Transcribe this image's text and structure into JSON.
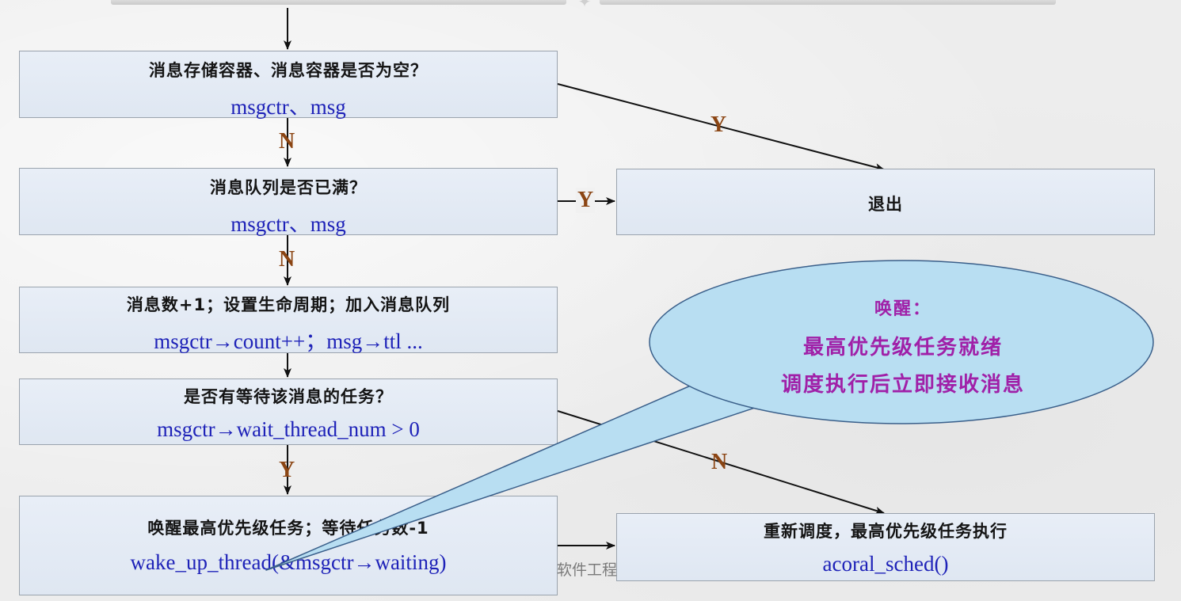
{
  "boxes": {
    "check_empty": {
      "zh": "消息存储容器、消息容器是否为空？",
      "en": "msgctr、msg"
    },
    "check_full": {
      "zh": "消息队列是否已满？",
      "en": "msgctr、msg"
    },
    "exit": {
      "zh": "退出"
    },
    "enqueue": {
      "zh": "消息数+1；设置生命周期；加入消息队列",
      "en": "msgctr→count++；msg→ttl ..."
    },
    "check_waiting": {
      "zh": "是否有等待该消息的任务？",
      "en": "msgctr→wait_thread_num > 0"
    },
    "wake_up": {
      "zh": "唤醒最高优先级任务；等待任务数-1",
      "en": "wake_up_thread(&msgctr→waiting)"
    },
    "resched": {
      "zh": "重新调度，最高优先级任务执行",
      "en": "acoral_sched()"
    }
  },
  "labels": {
    "n1": "N",
    "y1": "Y",
    "n2": "N",
    "y2": "Y",
    "y3": "Y",
    "n3": "N"
  },
  "callout": {
    "title": "唤醒：",
    "line1": "最高优先级任务就绪",
    "line2": "调度执行后立即接收消息"
  },
  "watermark": "软件工程",
  "colors": {
    "box_text": "#141414",
    "code_text": "#1e22b8",
    "label": "#8b4513",
    "callout_fill": "#b8def2",
    "callout_text": "#a020a8"
  }
}
